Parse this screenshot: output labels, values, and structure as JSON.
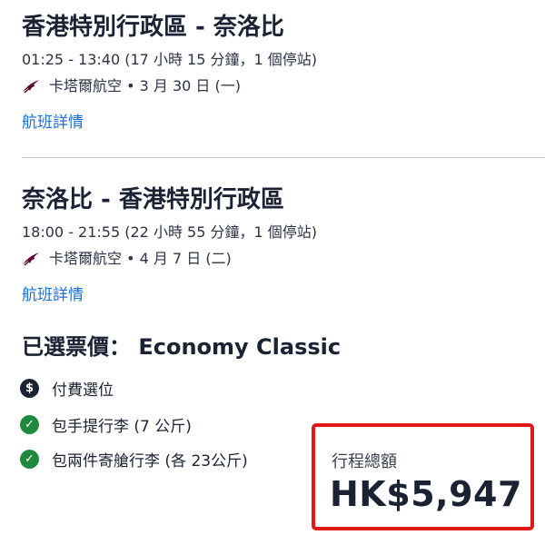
{
  "outbound": {
    "title": "香港特別行政區 - 奈洛比",
    "times": "01:25 - 13:40 (17 小時 15 分鐘，1 個停站)",
    "airline": "卡塔爾航空 • 3 月 30 日 (一)",
    "details_link": "航班詳情"
  },
  "inbound": {
    "title": "奈洛比 - 香港特別行政區",
    "times": "18:00 - 21:55 (22 小時 55 分鐘，1 個停站)",
    "airline": "卡塔爾航空 • 4 月 7 日 (二)",
    "details_link": "航班詳情"
  },
  "fare": {
    "heading": "已選票價： Economy Classic",
    "features": [
      {
        "icon": "dollar-icon",
        "label": "付費選位"
      },
      {
        "icon": "check-icon",
        "label": "包手提行李 (7 公斤)"
      },
      {
        "icon": "check-icon",
        "label": "包兩件寄艙行李 (各 23公斤)"
      }
    ]
  },
  "total": {
    "label": "行程總額",
    "amount": "HK$5,947"
  },
  "colors": {
    "link": "#1a6fd8",
    "highlight_border": "#e01818",
    "check": "#1f8a3f",
    "airline_brand": "#5c0632"
  }
}
